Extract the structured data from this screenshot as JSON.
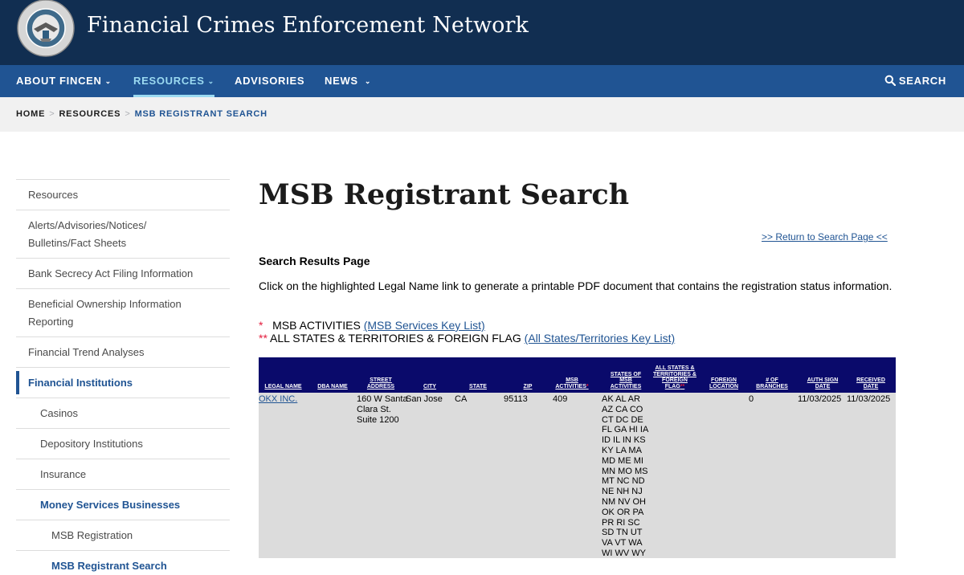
{
  "site": {
    "title": "Financial Crimes Enforcement Network",
    "seal_text": "U.S. TREASURY · FINANCIAL CRIMES ENFORCEMENT NETWORK"
  },
  "nav": {
    "items": [
      {
        "label": "ABOUT FINCEN",
        "has_menu": true
      },
      {
        "label": "RESOURCES",
        "has_menu": true,
        "active": true
      },
      {
        "label": "ADVISORIES",
        "has_menu": false
      },
      {
        "label": "NEWS",
        "has_menu": true
      }
    ],
    "search_label": "SEARCH"
  },
  "breadcrumb": [
    "HOME",
    "RESOURCES",
    "MSB REGISTRANT SEARCH"
  ],
  "sidebar": {
    "items": [
      {
        "label": "Resources"
      },
      {
        "label": "Alerts/Advisories/Notices/ Bulletins/Fact Sheets"
      },
      {
        "label": "Bank Secrecy Act Filing Information"
      },
      {
        "label": "Beneficial Ownership Information Reporting"
      },
      {
        "label": "Financial Trend Analyses"
      },
      {
        "label": "Financial Institutions"
      },
      {
        "label": "Casinos"
      },
      {
        "label": "Depository Institutions"
      },
      {
        "label": "Insurance"
      },
      {
        "label": "Money Services Businesses"
      },
      {
        "label": "MSB Registration"
      },
      {
        "label": "MSB Registrant Search"
      }
    ]
  },
  "main": {
    "title": "MSB Registrant Search",
    "return_link": ">> Return to Search Page <<",
    "results_heading": "Search Results Page",
    "instruction": "Click on the highlighted Legal Name link to generate a printable PDF document that contains the registration status information.",
    "key1": {
      "star": "*",
      "text": "MSB ACTIVITIES",
      "link": "(MSB Services Key List)"
    },
    "key2": {
      "star": "**",
      "text": "ALL STATES & TERRITORIES & FOREIGN FLAG",
      "link": "(All States/Territories Key List)"
    }
  },
  "table": {
    "headers": {
      "legal_name": "LEGAL NAME",
      "dba_name": "DBA NAME",
      "street_address": "STREET ADDRESS",
      "city": "CITY",
      "state": "STATE",
      "zip": "ZIP",
      "msb_activities": "MSB ACTIVITIES",
      "msb_activities_mark": "*",
      "states_of_msb_activities": "STATES OF MSB ACTIVITIES",
      "all_states_flag": "ALL STATES & TERRITORIES & FOREIGN FLAG",
      "all_states_flag_mark": "**",
      "foreign_location": "FOREIGN LOCATION",
      "branches": "# OF BRANCHES",
      "auth_sign_date": "AUTH SIGN DATE",
      "received_date": "RECEIVED DATE"
    },
    "row": {
      "legal_name": "OKX INC.",
      "dba_name": "",
      "street_address": "160 W Santa Clara St. Suite 1200",
      "city": "San Jose",
      "state": "CA",
      "zip": "95113",
      "msb_activities": "409",
      "states_of_msb_activities": "AK AL AR AZ CA CO CT DC DE FL GA HI IA ID IL IN KS KY LA MA MD ME MI MN MO MS MT NC ND NE NH NJ NM NV OH OK OR PA PR RI SC SD TN UT VA VT WA WI WV WY",
      "all_states_flag": "",
      "foreign_location": "",
      "branches": "0",
      "auth_sign_date": "11/03/2025",
      "received_date": "11/03/2025"
    }
  },
  "colors": {
    "header_bg": "#112e51",
    "nav_bg": "#205493",
    "nav_active": "#9bdaf1",
    "table_header_bg": "#0a0a6b",
    "table_body_bg": "#dcdcdc"
  }
}
